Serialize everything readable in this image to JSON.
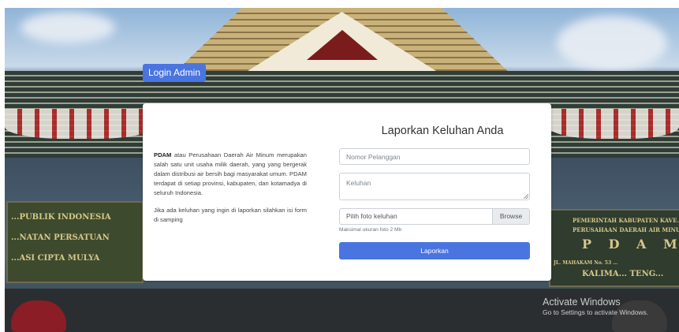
{
  "header": {
    "login_label": "Login Admin"
  },
  "description": {
    "brand": "PDAM",
    "para1_rest": " atau Perusahaan Daerah Air Minum merupakan salah satu unit usaha milik daerah, yang yang bergerak dalam distribusi air bersih bagi masyarakat umum. PDAM terdapat di setiap provinsi, kabupaten, dan kotamadya di seluruh Indonesia.",
    "para2": "Jika ada keluhan yang ingin di laporkan silahkan isi form di samping"
  },
  "form": {
    "title": "Laporkan Keluhan Anda",
    "customer_number_placeholder": "Nomor Pelanggan",
    "complaint_placeholder": "Keluhan",
    "photo_label": "Pilih foto keluhan",
    "browse_label": "Browse",
    "photo_hint": "Maksimal ukuran foto 2 Mb",
    "submit_label": "Laporkan"
  },
  "background": {
    "sign_left_lines": [
      "...PUBLIK INDONESIA",
      "...NATAN PERSATUAN",
      "...ASI CIPTA MULYA"
    ],
    "sign_right_lines": [
      "PEMERINTAH KABUPATEN KAVE...",
      "PERUSAHAAN DAERAH AIR MINUM",
      "P D A M",
      "JL. MAHAKAM No. 53 ...",
      "KALIMA... TENG..."
    ]
  },
  "watermark": {
    "title": "Activate Windows",
    "subtitle": "Go to Settings to activate Windows."
  },
  "colors": {
    "primary": "#4a74e0",
    "card": "#ffffff"
  }
}
